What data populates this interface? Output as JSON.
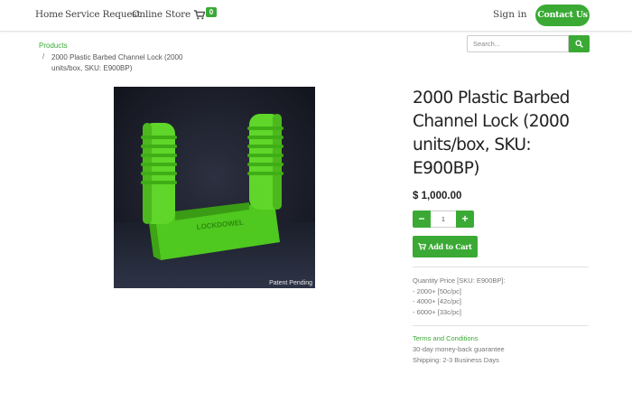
{
  "nav": {
    "links": [
      "Home",
      "Service Request",
      "Online Store"
    ],
    "cart_count": "0",
    "sign_in": "Sign in",
    "contact": "Contact Us"
  },
  "breadcrumb": {
    "products": "Products",
    "separator": "/",
    "current": "2000 Plastic Barbed Channel Lock (2000 units/box, SKU: E900BP)"
  },
  "search": {
    "placeholder": "Search..."
  },
  "product": {
    "image_caption": "Patent Pending",
    "image_text": "LOCKDOWEL",
    "title": "2000 Plastic Barbed Channel Lock (2000 units/box, SKU: E900BP)",
    "price": "$ 1,000.00",
    "quantity": "1",
    "minus": "−",
    "plus": "+",
    "add_to_cart": "Add to Cart"
  },
  "quantity_price": {
    "heading": "Quantity Price [SKU: E900BP]:",
    "tiers": [
      "- 2000+ [50c/pc]",
      "- 4000+ [42c/pc]",
      "- 6000+ [33c/pc]"
    ]
  },
  "terms": {
    "link": "Terms and Conditions",
    "lines": [
      "30-day money-back guarantee",
      "Shipping: 2-3 Business Days"
    ]
  },
  "colors": {
    "accent": "#3aaa35",
    "product_green": "#5fd629"
  }
}
